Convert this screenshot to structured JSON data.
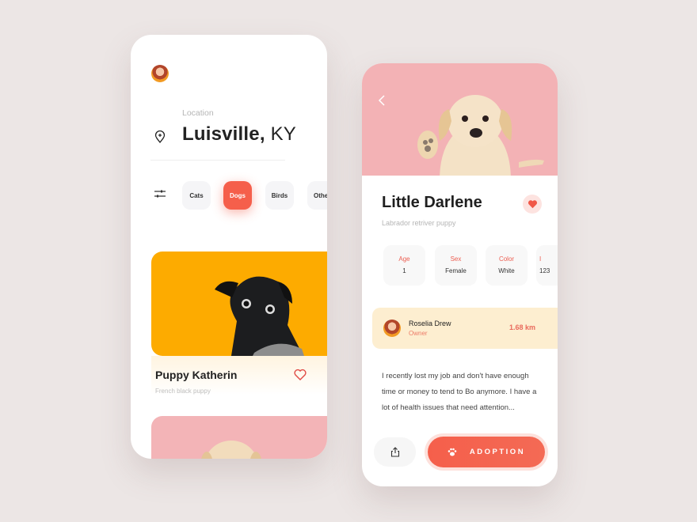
{
  "colors": {
    "accent": "#f55f4b",
    "pug_bg": "#fdab00",
    "lab_bg": "#f3b2b5",
    "owner_bg": "#fdeed0"
  },
  "browse": {
    "location_label": "Location",
    "city_bold": "Luisville,",
    "city_state": " KY",
    "categories": [
      {
        "label": "Cats",
        "active": false
      },
      {
        "label": "Dogs",
        "active": true
      },
      {
        "label": "Birds",
        "active": false
      },
      {
        "label": "Othe",
        "active": false
      }
    ],
    "pets": [
      {
        "name": "Puppy Katherin",
        "breed": "French black puppy"
      }
    ]
  },
  "detail": {
    "name": "Little Darlene",
    "breed": "Labrador retriver puppy",
    "stats": [
      {
        "key": "Age",
        "value": "1"
      },
      {
        "key": "Sex",
        "value": "Female"
      },
      {
        "key": "Color",
        "value": "White"
      },
      {
        "key": "I",
        "value": "123"
      }
    ],
    "owner": {
      "name": "Roselia Drew",
      "role": "Owner",
      "distance": "1.68 km"
    },
    "description": "I recently lost my job and don't have enough time or money to tend to Bo anymore. I have a lot of health issues that need attention...",
    "adopt_label": "ADOPTION"
  }
}
